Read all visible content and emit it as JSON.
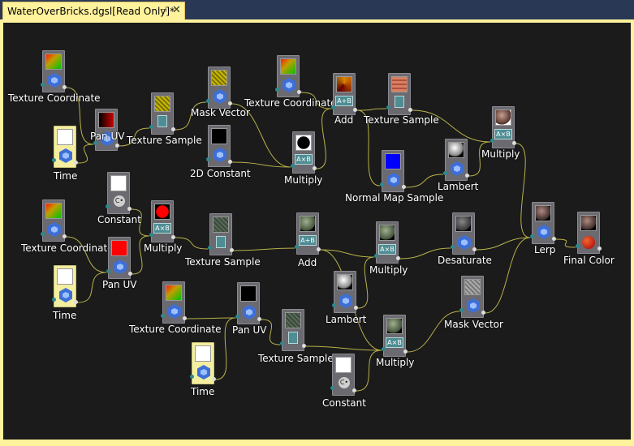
{
  "tab": {
    "title": "WaterOverBricks.dgsl[Read Only]*",
    "pin_glyph": "⊣",
    "close_glyph": "✕"
  },
  "nodes": [
    {
      "id": "n0",
      "label": "Texture Coordinate",
      "kind": "texcoord"
    },
    {
      "id": "n1",
      "label": "Pan UV",
      "kind": "panuv"
    },
    {
      "id": "n2",
      "label": "Time",
      "kind": "time"
    },
    {
      "id": "n3",
      "label": "Texture Sample",
      "kind": "texsample-yellow"
    },
    {
      "id": "n4",
      "label": "Mask Vector",
      "kind": "mask-yellow"
    },
    {
      "id": "n5",
      "label": "2D Constant",
      "kind": "constant-black"
    },
    {
      "id": "n6",
      "label": "Texture Coordinate",
      "kind": "texcoord"
    },
    {
      "id": "n7",
      "label": "Multiply",
      "kind": "multiply-black"
    },
    {
      "id": "n8",
      "label": "Add",
      "kind": "add-orange"
    },
    {
      "id": "n9",
      "label": "Texture Sample",
      "kind": "texsample-brick"
    },
    {
      "id": "n10",
      "label": "Normal Map Sample",
      "kind": "normalmap"
    },
    {
      "id": "n11",
      "label": "Lambert",
      "kind": "lambert"
    },
    {
      "id": "n12",
      "label": "Multiply",
      "kind": "multiply-brown"
    },
    {
      "id": "n13",
      "label": "Constant",
      "kind": "constant-white"
    },
    {
      "id": "n14",
      "label": "Texture Coordinate",
      "kind": "texcoord"
    },
    {
      "id": "n15",
      "label": "Multiply",
      "kind": "multiply-red"
    },
    {
      "id": "n16",
      "label": "Pan UV",
      "kind": "panuv-red"
    },
    {
      "id": "n17",
      "label": "Time",
      "kind": "time"
    },
    {
      "id": "n18",
      "label": "Texture Sample",
      "kind": "texsample-gray"
    },
    {
      "id": "n19",
      "label": "Add",
      "kind": "add-green"
    },
    {
      "id": "n20",
      "label": "Multiply",
      "kind": "multiply-green"
    },
    {
      "id": "n21",
      "label": "Desaturate",
      "kind": "desaturate"
    },
    {
      "id": "n22",
      "label": "Lerp",
      "kind": "lerp"
    },
    {
      "id": "n23",
      "label": "Final Color",
      "kind": "final"
    },
    {
      "id": "n24",
      "label": "Lambert",
      "kind": "lambert"
    },
    {
      "id": "n25",
      "label": "Texture Coordinate",
      "kind": "texcoord"
    },
    {
      "id": "n26",
      "label": "Pan UV",
      "kind": "panuv-black"
    },
    {
      "id": "n27",
      "label": "Mask Vector",
      "kind": "mask-gray"
    },
    {
      "id": "n28",
      "label": "Texture Sample",
      "kind": "texsample-gray"
    },
    {
      "id": "n29",
      "label": "Time",
      "kind": "time"
    },
    {
      "id": "n30",
      "label": "Multiply",
      "kind": "multiply-green"
    },
    {
      "id": "n31",
      "label": "Constant",
      "kind": "constant-white"
    }
  ],
  "colors": {
    "wire": "#B8B24A",
    "canvas": "#1B1B1B",
    "tab": "#FFF29D",
    "chrome": "#293955"
  }
}
